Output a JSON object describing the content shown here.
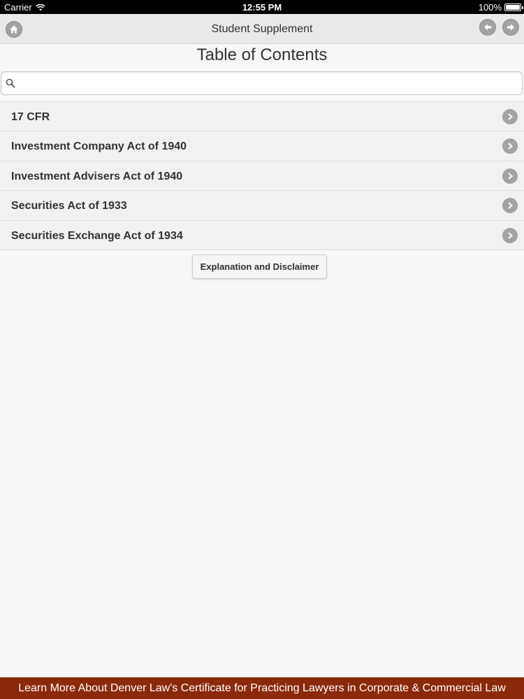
{
  "status_bar": {
    "carrier": "Carrier",
    "time": "12:55 PM",
    "battery": "100%"
  },
  "nav": {
    "title": "Student Supplement",
    "icons": [
      "home-icon",
      "back-arrow-icon",
      "forward-arrow-icon"
    ]
  },
  "page": {
    "title": "Table of Contents"
  },
  "search": {
    "value": "",
    "placeholder": ""
  },
  "toc": {
    "items": [
      {
        "label": "17 CFR"
      },
      {
        "label": "Investment Company Act of 1940"
      },
      {
        "label": "Investment Advisers Act of 1940"
      },
      {
        "label": "Securities Act of 1933"
      },
      {
        "label": "Securities Exchange Act of 1934"
      }
    ]
  },
  "disclaimer_button": {
    "label": "Explanation and Disclaimer"
  },
  "footer": {
    "text": "Learn More About Denver Law's Certificate for Practicing Lawyers in Corporate & Commercial Law"
  },
  "colors": {
    "background": "#f7f6f8",
    "nav_background": "#e9e8ea",
    "list_row": "#f1f0f2",
    "icon_gray": "#a3a3a6",
    "footer_brand": "#8b2a0a"
  }
}
